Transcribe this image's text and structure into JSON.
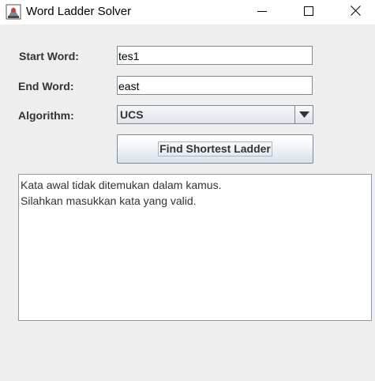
{
  "window": {
    "title": "Word Ladder Solver",
    "icon": "java-app-icon",
    "controls": [
      "minimize-icon",
      "maximize-icon",
      "close-icon"
    ]
  },
  "form": {
    "start_word": {
      "label": "Start Word:",
      "value": "tes1"
    },
    "end_word": {
      "label": "End Word:",
      "value": "east"
    },
    "algorithm": {
      "label": "Algorithm:",
      "selected": "UCS"
    },
    "submit_label": "Find Shortest Ladder"
  },
  "output": {
    "lines": [
      "Kata awal tidak ditemukan dalam kamus.",
      "Silahkan masukkan kata yang valid."
    ]
  }
}
